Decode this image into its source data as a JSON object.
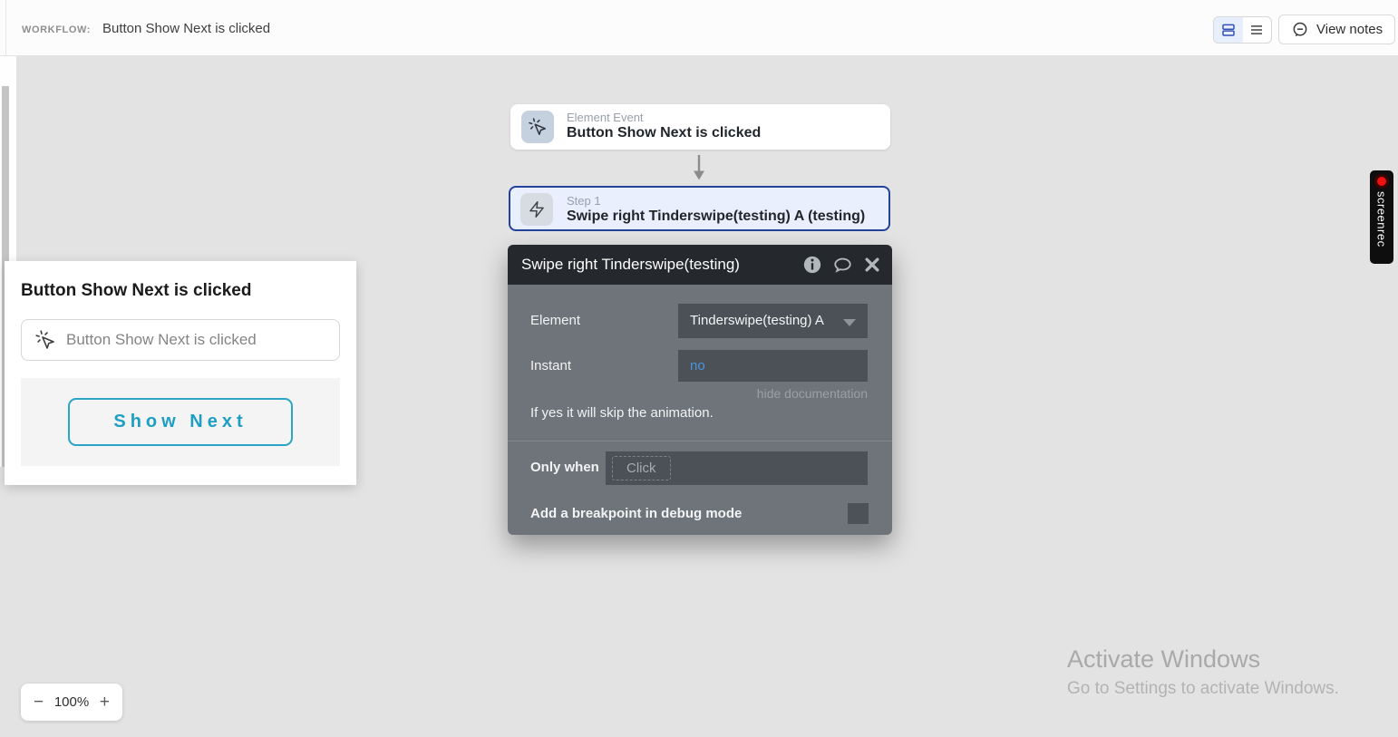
{
  "topbar": {
    "workflow_label": "WORKFLOW:",
    "workflow_title": "Button Show Next is clicked",
    "view_notes_label": "View notes"
  },
  "canvas": {
    "event_card": {
      "kicker": "Element Event",
      "title": "Button Show Next is clicked"
    },
    "step_card": {
      "kicker": "Step 1",
      "title": "Swipe right Tinderswipe(testing) A (testing)"
    }
  },
  "action_popup": {
    "title": "Swipe right Tinderswipe(testing)",
    "element_label": "Element",
    "element_value": "Tinderswipe(testing) A",
    "instant_label": "Instant",
    "instant_value": "no",
    "hide_documentation": "hide documentation",
    "doc_text": "If yes it will skip the animation.",
    "only_when_label": "Only when",
    "only_when_placeholder": "Click",
    "breakpoint_label": "Add a breakpoint in debug mode"
  },
  "preview_card": {
    "title": "Button Show Next is clicked",
    "event_row_text": "Button Show Next is clicked",
    "button_label": "Show Next"
  },
  "zoom_control": {
    "minus": "−",
    "level": "100%",
    "plus": "+"
  },
  "screenrec": {
    "label": "screenrec"
  },
  "watermark": {
    "line1": "Activate Windows",
    "line2": "Go to Settings to activate Windows."
  },
  "colors": {
    "canvas_bg": "#e3e3e3",
    "popup_header": "#25292d",
    "popup_body": "#6e747a",
    "popup_field": "#4b5157",
    "step_border": "#24439d",
    "step_bg": "#e9effc",
    "instant_value_blue": "#4b94dd",
    "teal_accent": "#2ba4c6",
    "toggle_selected_blue": "#3550b4",
    "record_red": "#ee1111"
  }
}
